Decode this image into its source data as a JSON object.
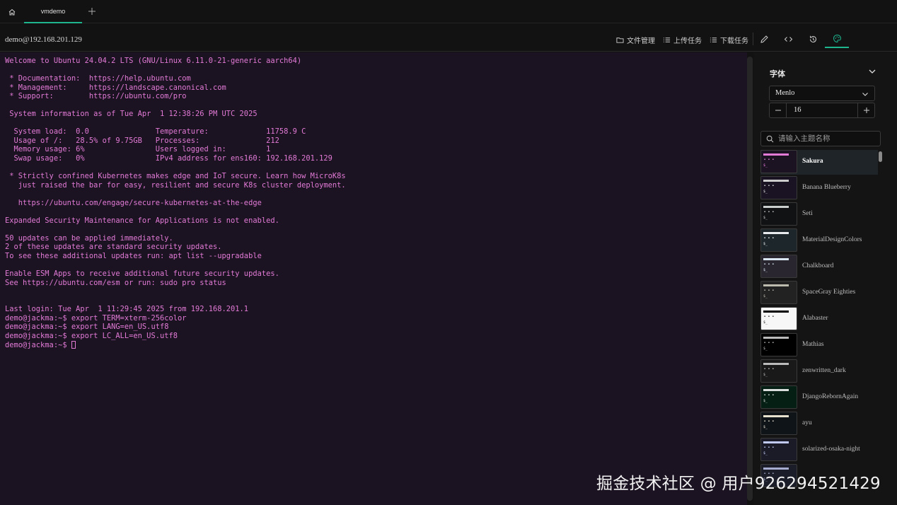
{
  "tabs": {
    "home_icon": "home-icon",
    "active_tab_label": "vmdemo",
    "add_icon": "plus-icon",
    "accent_color": "#1db48e"
  },
  "toolbar": {
    "host": "demo@192.168.201.129",
    "file_manager_label": "文件管理",
    "upload_tasks_label": "上传任务",
    "download_tasks_label": "下载任务",
    "icons": [
      "edit-icon",
      "code-icon",
      "history-icon",
      "palette-icon"
    ]
  },
  "terminal": {
    "text_color": "#e27ad6",
    "background": "#1c1322",
    "lines": [
      "Welcome to Ubuntu 24.04.2 LTS (GNU/Linux 6.11.0-21-generic aarch64)",
      "",
      " * Documentation:  https://help.ubuntu.com",
      " * Management:     https://landscape.canonical.com",
      " * Support:        https://ubuntu.com/pro",
      "",
      " System information as of Tue Apr  1 12:38:26 PM UTC 2025",
      "",
      "  System load:  0.0               Temperature:             11758.9 C",
      "  Usage of /:   28.5% of 9.75GB   Processes:               212",
      "  Memory usage: 6%                Users logged in:         1",
      "  Swap usage:   0%                IPv4 address for ens160: 192.168.201.129",
      "",
      " * Strictly confined Kubernetes makes edge and IoT secure. Learn how MicroK8s",
      "   just raised the bar for easy, resilient and secure K8s cluster deployment.",
      "",
      "   https://ubuntu.com/engage/secure-kubernetes-at-the-edge",
      "",
      "Expanded Security Maintenance for Applications is not enabled.",
      "",
      "50 updates can be applied immediately.",
      "2 of these updates are standard security updates.",
      "To see these additional updates run: apt list --upgradable",
      "",
      "Enable ESM Apps to receive additional future security updates.",
      "See https://ubuntu.com/esm or run: sudo pro status",
      "",
      "",
      "Last login: Tue Apr  1 11:29:45 2025 from 192.168.201.1",
      "demo@jackma:~$ export TERM=xterm-256color",
      "demo@jackma:~$ export LANG=en_US.utf8",
      "demo@jackma:~$ export LC_ALL=en_US.utf8"
    ],
    "prompt": "demo@jackma:~$ "
  },
  "font_panel": {
    "title": "字体",
    "font_family": "Menlo",
    "font_size": "16"
  },
  "theme_search": {
    "placeholder": "请输入主题名称"
  },
  "themes": [
    {
      "name": "Sakura",
      "bg": "#1c1322",
      "bar": "#e27ad6",
      "dots": "#e27ad6",
      "selected": true
    },
    {
      "name": "Banana Blueberry",
      "bg": "#191323",
      "bar": "#cccccc",
      "dots": "#dddddd",
      "selected": false
    },
    {
      "name": "Seti",
      "bg": "#111213",
      "bar": "#cacecd",
      "dots": "#cacecd",
      "selected": false
    },
    {
      "name": "MaterialDesignColors",
      "bg": "#1d262a",
      "bar": "#e7ebed",
      "dots": "#e7ebed",
      "selected": false
    },
    {
      "name": "Chalkboard",
      "bg": "#29262f",
      "bar": "#d9e6f2",
      "dots": "#d9e6f2",
      "selected": false
    },
    {
      "name": "SpaceGray Eighties",
      "bg": "#222222",
      "bar": "#bdbaae",
      "dots": "#bdbaae",
      "selected": false
    },
    {
      "name": "Alabaster",
      "bg": "#f7f7f7",
      "bar": "#000000",
      "dots": "#333333",
      "selected": false
    },
    {
      "name": "Mathias",
      "bg": "#000000",
      "bar": "#bbbbbb",
      "dots": "#bbbbbb",
      "selected": false
    },
    {
      "name": "zenwritten_dark",
      "bg": "#191919",
      "bar": "#bbbbbb",
      "dots": "#bbbbbb",
      "selected": false
    },
    {
      "name": "DjangoRebornAgain",
      "bg": "#051f14",
      "bar": "#dadedc",
      "dots": "#dadedc",
      "selected": false
    },
    {
      "name": "ayu",
      "bg": "#0f1419",
      "bar": "#e6e1cf",
      "dots": "#e6e1cf",
      "selected": false
    },
    {
      "name": "solarized-osaka-night",
      "bg": "#1a1b26",
      "bar": "#c0caf5",
      "dots": "#c0caf5",
      "selected": false
    },
    {
      "name": "",
      "bg": "#1b1e28",
      "bar": "#a6accd",
      "dots": "#a6accd",
      "selected": false
    }
  ],
  "watermark": "掘金技术社区 @ 用户926294521429"
}
